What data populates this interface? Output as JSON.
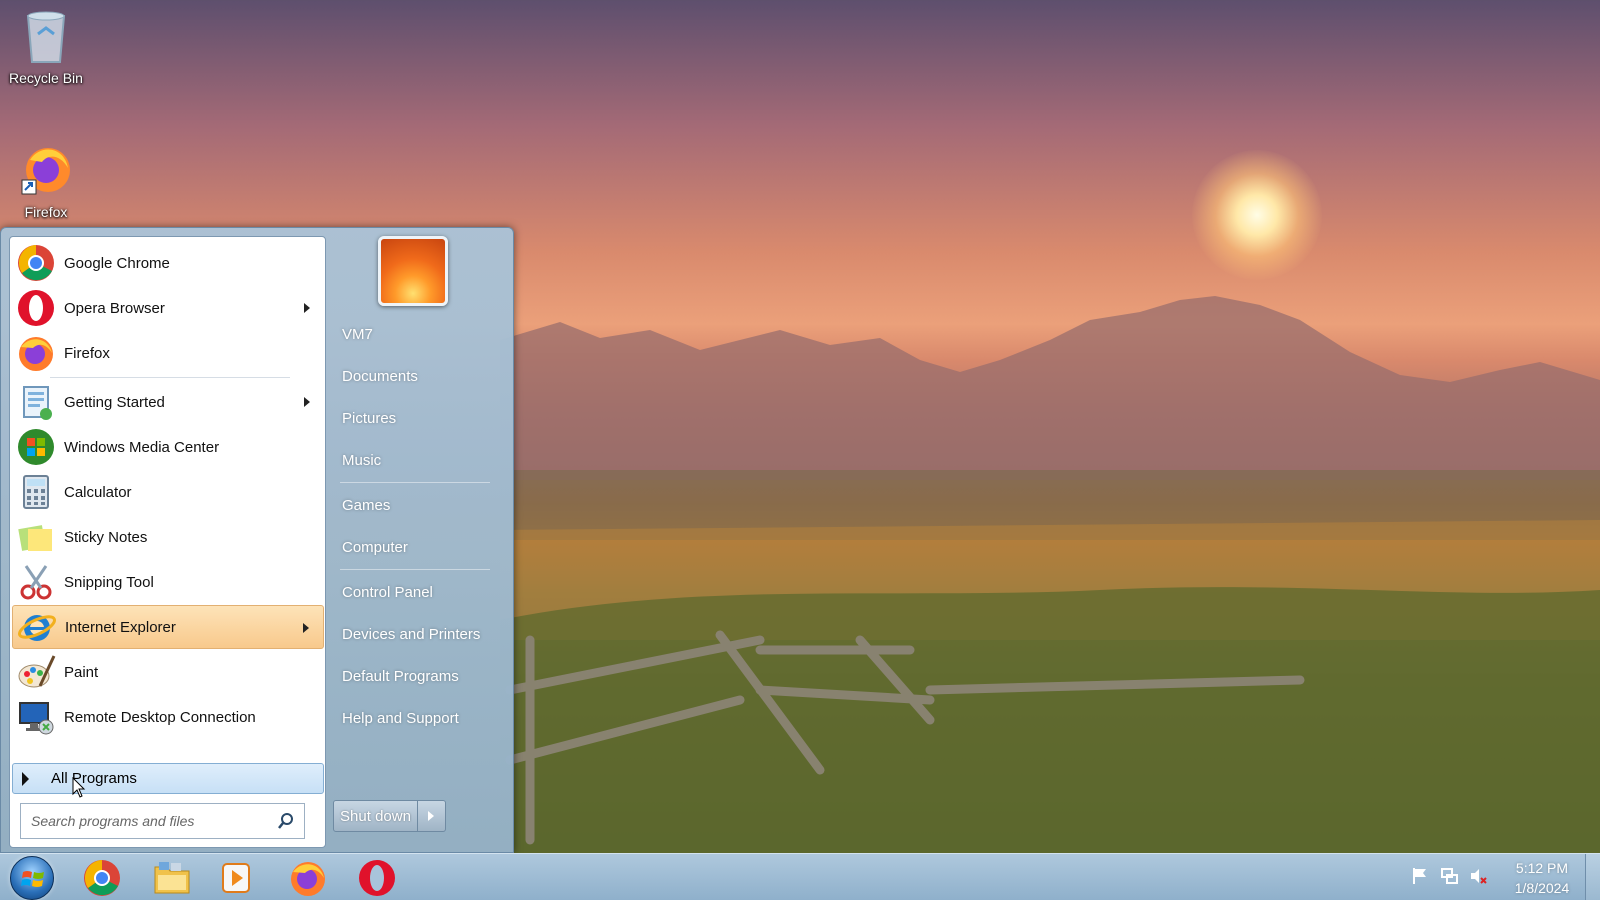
{
  "desktop": {
    "icons": [
      {
        "label": "Recycle Bin",
        "icon": "recycle-bin-icon"
      },
      {
        "label": "Firefox",
        "icon": "firefox-icon"
      }
    ]
  },
  "start_menu": {
    "programs": [
      {
        "label": "Google Chrome",
        "icon": "chrome-icon",
        "submenu": false
      },
      {
        "label": "Opera Browser",
        "icon": "opera-icon",
        "submenu": true
      },
      {
        "label": "Firefox",
        "icon": "firefox-icon",
        "submenu": false
      },
      {
        "label": "Getting Started",
        "icon": "getting-started-icon",
        "submenu": true
      },
      {
        "label": "Windows Media Center",
        "icon": "media-center-icon",
        "submenu": false
      },
      {
        "label": "Calculator",
        "icon": "calculator-icon",
        "submenu": false
      },
      {
        "label": "Sticky Notes",
        "icon": "sticky-notes-icon",
        "submenu": false
      },
      {
        "label": "Snipping Tool",
        "icon": "snipping-tool-icon",
        "submenu": false
      },
      {
        "label": "Internet Explorer",
        "icon": "internet-explorer-icon",
        "submenu": true,
        "highlighted": true
      },
      {
        "label": "Paint",
        "icon": "paint-icon",
        "submenu": false
      },
      {
        "label": "Remote Desktop Connection",
        "icon": "remote-desktop-icon",
        "submenu": false
      }
    ],
    "all_programs_label": "All Programs",
    "search_placeholder": "Search programs and files",
    "right_links": [
      "VM7",
      "Documents",
      "Pictures",
      "Music",
      "Games",
      "Computer",
      "Control Panel",
      "Devices and Printers",
      "Default Programs",
      "Help and Support"
    ],
    "shutdown_label": "Shut down"
  },
  "taskbar": {
    "pinned": [
      "chrome-icon",
      "file-explorer-icon",
      "media-player-icon",
      "firefox-icon",
      "opera-icon"
    ],
    "tray_icons": [
      "action-center-flag-icon",
      "network-icon",
      "volume-muted-icon"
    ],
    "time": "5:12 PM",
    "date": "1/8/2024"
  },
  "colors": {
    "highlight": "#f8c98c",
    "all_programs_bg": "#c7e0f6",
    "taskbar": "#9fbcd4"
  }
}
